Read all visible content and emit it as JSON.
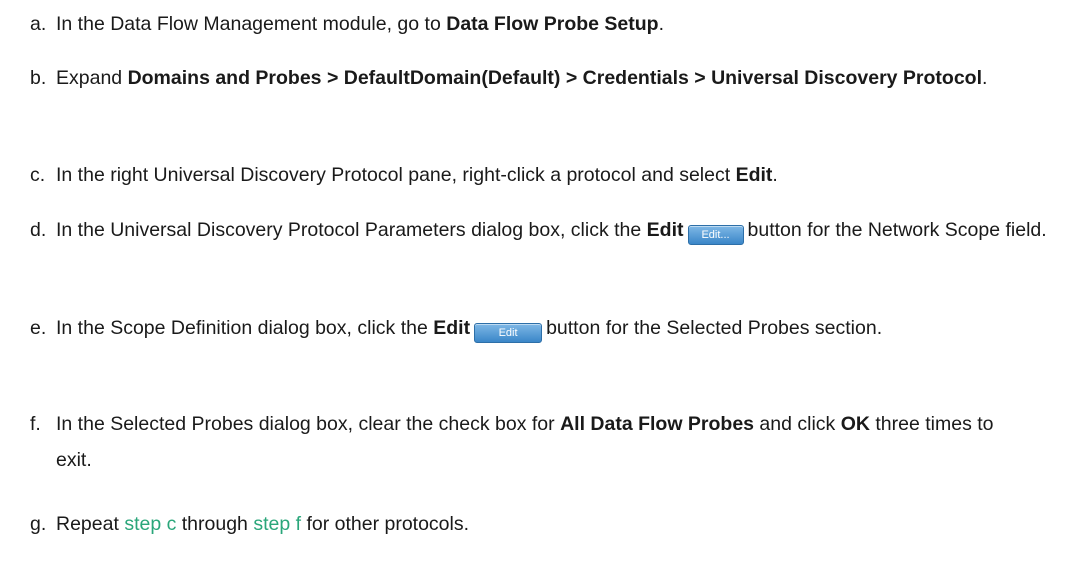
{
  "steps": [
    {
      "marker": "a.",
      "t1": "In the Data Flow Management module, go to ",
      "b1": "Data Flow Probe Setup",
      "t2": "."
    },
    {
      "marker": "b.",
      "t1": "Expand ",
      "b1": "Domains and Probes > DefaultDomain(Default) > Credentials > Universal Discovery Protocol",
      "t2": "."
    },
    {
      "marker": "c.",
      "t1": "In the right Universal Discovery Protocol pane, right-click a protocol and select ",
      "b1": "Edit",
      "t2": "."
    },
    {
      "marker": "d.",
      "t1": "In the Universal Discovery Protocol Parameters dialog box, click the ",
      "b1": "Edit",
      "button": "Edit...",
      "t2": "button for the Network Scope field."
    },
    {
      "marker": "e.",
      "t1": "In the Scope Definition dialog box, click the ",
      "b1": "Edit",
      "button": "Edit",
      "t2": "button for the Selected Probes section."
    },
    {
      "marker": "f.",
      "t1": "In the Selected Probes dialog box, clear the check box for ",
      "b1": "All Data Flow Probes",
      "t2": " and click ",
      "b2": "OK",
      "t3": " three times to exit."
    },
    {
      "marker": "g.",
      "t1": "Repeat ",
      "link1": "step c",
      "t2": " through ",
      "link2": "step f",
      "t3": " for other protocols."
    }
  ],
  "colors": {
    "link": "#2aa67a",
    "text": "#1a1a1a",
    "button": "#3a86c8"
  }
}
